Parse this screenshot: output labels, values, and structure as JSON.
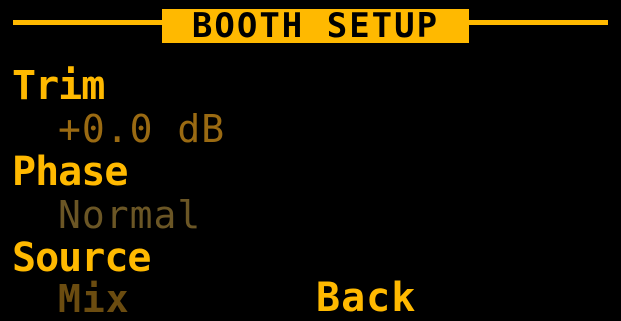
{
  "header": {
    "title": "BOOTH SETUP"
  },
  "settings": [
    {
      "label": "Trim",
      "value": "+0.0 dB"
    },
    {
      "label": "Phase",
      "value": "Normal"
    },
    {
      "label": "Source",
      "value": "Mix"
    }
  ],
  "actions": {
    "back_label": "Back"
  },
  "colors": {
    "accent": "#ffb900",
    "background": "#000000",
    "value_dim": "#9a6a12",
    "value_dimmer": "#6b5625"
  }
}
